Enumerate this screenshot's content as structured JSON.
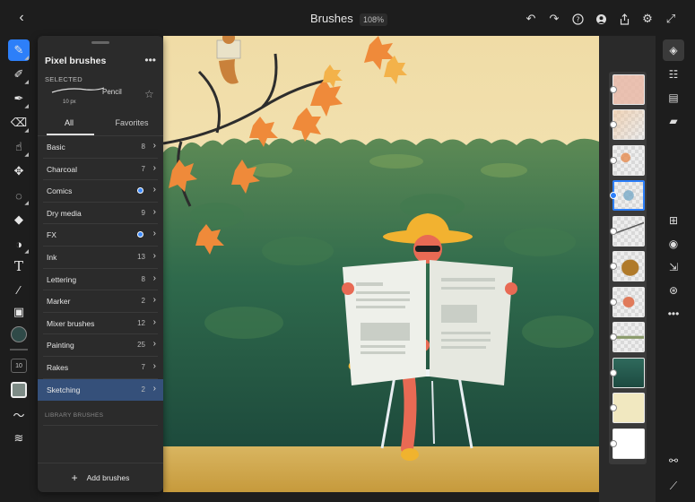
{
  "header": {
    "title": "Brushes",
    "zoom": "108%"
  },
  "brush_panel": {
    "title": "Pixel brushes",
    "selected_label": "SELECTED",
    "selected_brush": {
      "name": "Pencil",
      "size": "10 px"
    },
    "tabs": {
      "all": "All",
      "favorites": "Favorites"
    },
    "categories": [
      {
        "name": "Basic",
        "count": "8"
      },
      {
        "name": "Charcoal",
        "count": "7"
      },
      {
        "name": "Comics",
        "count": ""
      },
      {
        "name": "Dry media",
        "count": "9"
      },
      {
        "name": "FX",
        "count": ""
      },
      {
        "name": "Ink",
        "count": "13"
      },
      {
        "name": "Lettering",
        "count": "8"
      },
      {
        "name": "Marker",
        "count": "2"
      },
      {
        "name": "Mixer brushes",
        "count": "12"
      },
      {
        "name": "Painting",
        "count": "25"
      },
      {
        "name": "Rakes",
        "count": "7"
      },
      {
        "name": "Sketching",
        "count": "2"
      }
    ],
    "library_label": "LIBRARY BRUSHES",
    "add_label": "Add brushes"
  },
  "left_tools": {
    "brush_size": "10",
    "current_color": "#2f4a48",
    "swatch_color": "#7d8b86"
  },
  "colors": {
    "accent": "#2d7ff9",
    "selected_row": "#35507a"
  }
}
